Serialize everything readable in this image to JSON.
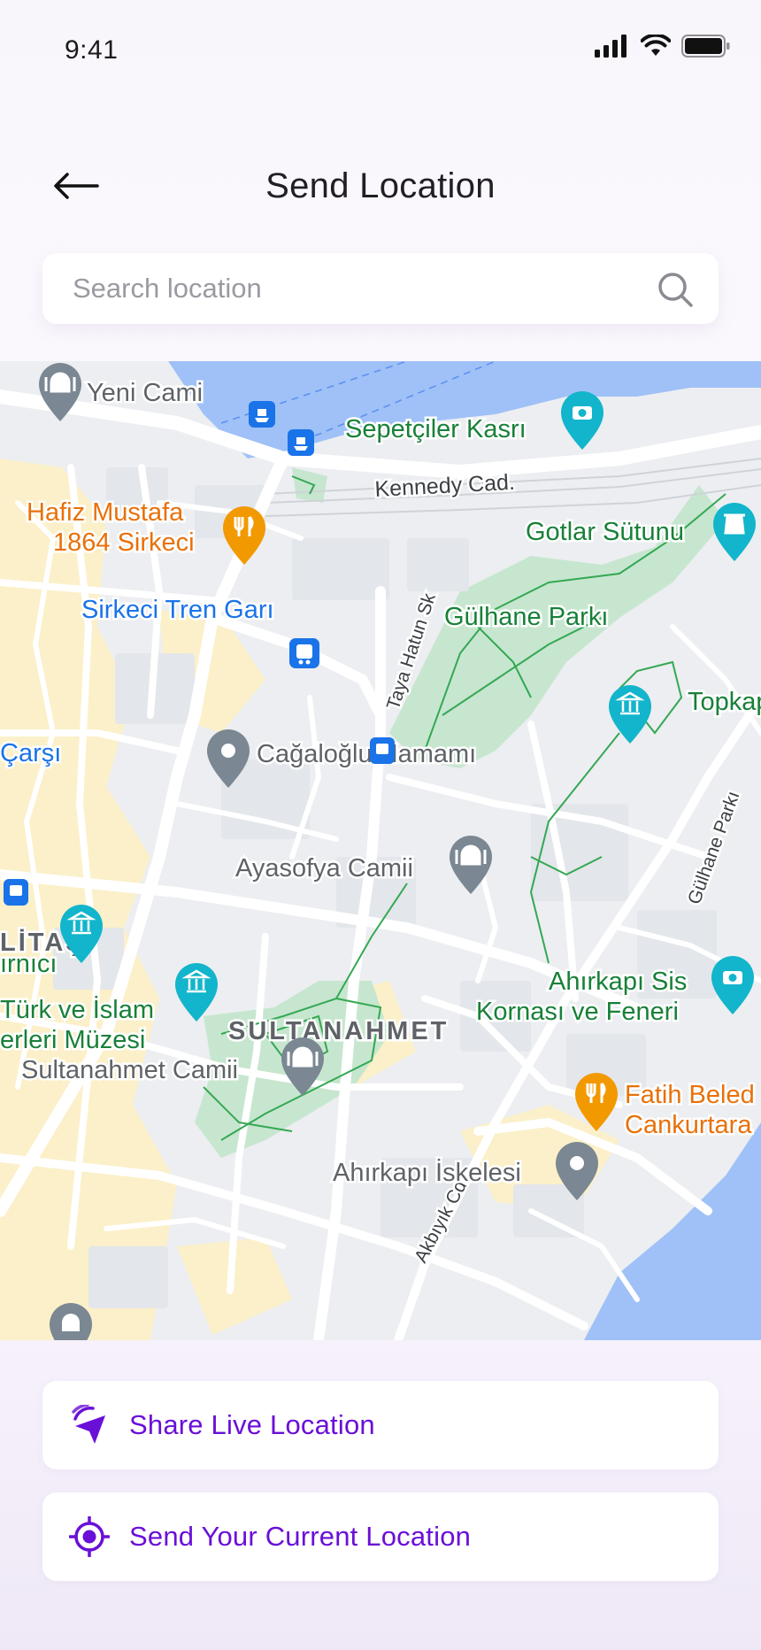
{
  "status_bar": {
    "time": "9:41",
    "icons": [
      "signal-icon",
      "wifi-icon",
      "battery-icon"
    ]
  },
  "header": {
    "title": "Send Location",
    "back_icon": "arrow-left-icon"
  },
  "search": {
    "placeholder": "Search location",
    "value": "",
    "icon": "search-icon"
  },
  "map": {
    "labels": {
      "yeni_cami": "Yeni Cami",
      "sepetciler": "Sepetçiler Kasrı",
      "kennedy": "Kennedy Cad.",
      "hafiz_1": "Hafiz Mustafa",
      "hafiz_2": "1864 Sirkeci",
      "gotlar": "Gotlar Sütunu",
      "sirkeci": "Sirkeci Tren Garı",
      "taya": "Taya Hatun Sk",
      "gulhane": "Gülhane Parkı",
      "topkapi": "Topkapı",
      "carsi": "Çarşı",
      "cagaloglu": "Cağaloğlu Hamamı",
      "gulhane_parki_road": "Gülhane Parkı",
      "litas": "LİTAŞ",
      "ayasofya": "Ayasofya Camii",
      "sultanahmet": "SULTANAHMET",
      "irnici": "ırnıcı",
      "turk_1": "Türk ve İslam",
      "turk_2": "erleri Müzesi",
      "ahirkapi_1": "Ahırkapı Sis",
      "ahirkapi_2": "Kornası ve Feneri",
      "sultanahmet_camii": "Sultanahmet Camii",
      "akbiyik": "Akbıyık Cd.",
      "fatih_1": "Fatih Beled",
      "fatih_2": "Cankurtara",
      "ahirkapi_iskelesi": "Ahırkapı İskelesi"
    },
    "colors": {
      "water": "#9fc1f7",
      "park": "#c7e6cf",
      "road": "#ffffff",
      "block": "#e9ebee",
      "district": "#fbf0c9",
      "poi_blue": "#1565c0",
      "poi_orange": "#e8710a",
      "poi_teal": "#12b5cb",
      "poi_green": "#188038"
    }
  },
  "actions": [
    {
      "label": "Share Live Location",
      "icon": "live-location-icon"
    },
    {
      "label": "Send Your Current Location",
      "icon": "current-location-icon"
    }
  ],
  "accent_color": "#6a0fd8"
}
